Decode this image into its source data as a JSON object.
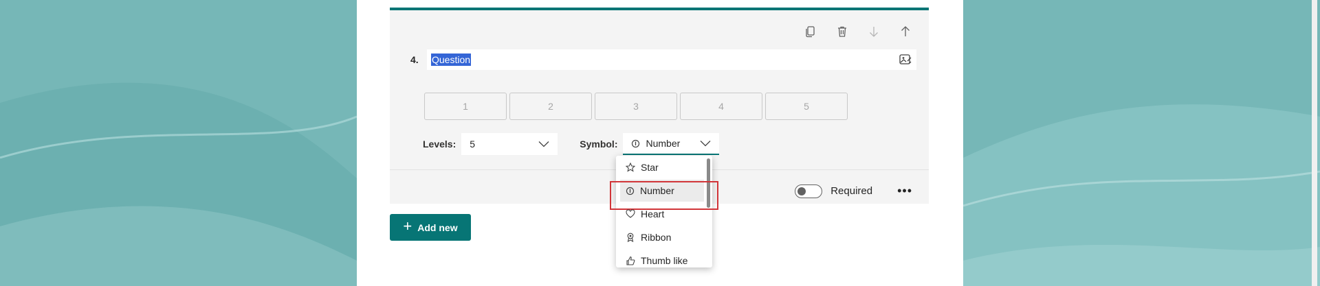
{
  "question": {
    "number": "4.",
    "text": "Question"
  },
  "rating_levels": [
    "1",
    "2",
    "3",
    "4",
    "5"
  ],
  "levels": {
    "label": "Levels:",
    "value": "5"
  },
  "symbol": {
    "label": "Symbol:",
    "value": "Number"
  },
  "dropdown": {
    "items": [
      {
        "label": "Star",
        "icon": "star-icon"
      },
      {
        "label": "Number",
        "icon": "number-icon",
        "selected": true
      },
      {
        "label": "Heart",
        "icon": "heart-icon"
      },
      {
        "label": "Ribbon",
        "icon": "ribbon-icon"
      },
      {
        "label": "Thumb like",
        "icon": "thumb-like-icon"
      }
    ]
  },
  "required": {
    "label": "Required",
    "on": false
  },
  "more_label": "•••",
  "add_new_label": "Add new",
  "colors": {
    "accent": "#077575",
    "highlight": "#d13438",
    "selection": "#3465d6"
  }
}
